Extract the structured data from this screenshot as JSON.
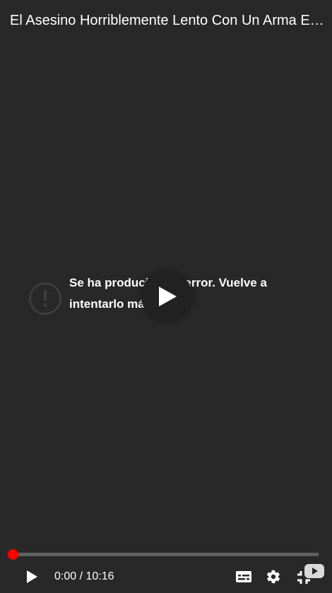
{
  "video": {
    "title": "El Asesino Horriblemente Lento Con Un Arma Extremadamente Ineficiente"
  },
  "error": {
    "icon": "exclamation-circle-icon",
    "message": "Se ha producido un error. Vuelve a intentarlo más tarde."
  },
  "controls": {
    "current_time": "0:00",
    "separator": " / ",
    "duration": "10:16",
    "progress": 0,
    "icons": {
      "play": "play-icon",
      "subtitles": "subtitles-icon",
      "settings": "gear-icon",
      "fullscreen_exit": "exit-fullscreen-icon",
      "youtube": "youtube-logo-icon"
    }
  },
  "colors": {
    "background": "#282828",
    "progress_played": "#ff0000",
    "progress_track": "#5f5f5f",
    "text": "#ffffff",
    "error_icon": "#3c3c3c"
  }
}
